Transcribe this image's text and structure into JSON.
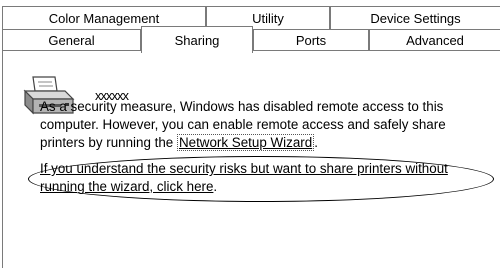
{
  "tabs_row1": [
    "Color Management",
    "Utility",
    "Device Settings"
  ],
  "tabs_row2": [
    "General",
    "Sharing",
    "Ports",
    "Advanced"
  ],
  "active_tab": "Sharing",
  "printer": {
    "name": "xxxxxx",
    "icon": "printer-icon"
  },
  "message": {
    "text": "As a security measure, Windows has disabled remote access to this computer. However, you can enable remote access and safely share printers by running the ",
    "wizard_link": "Network Setup Wizard",
    "end": "."
  },
  "share_link": "If you understand the security risks but want to share printers without running the wizard, click here",
  "share_link_end": "."
}
